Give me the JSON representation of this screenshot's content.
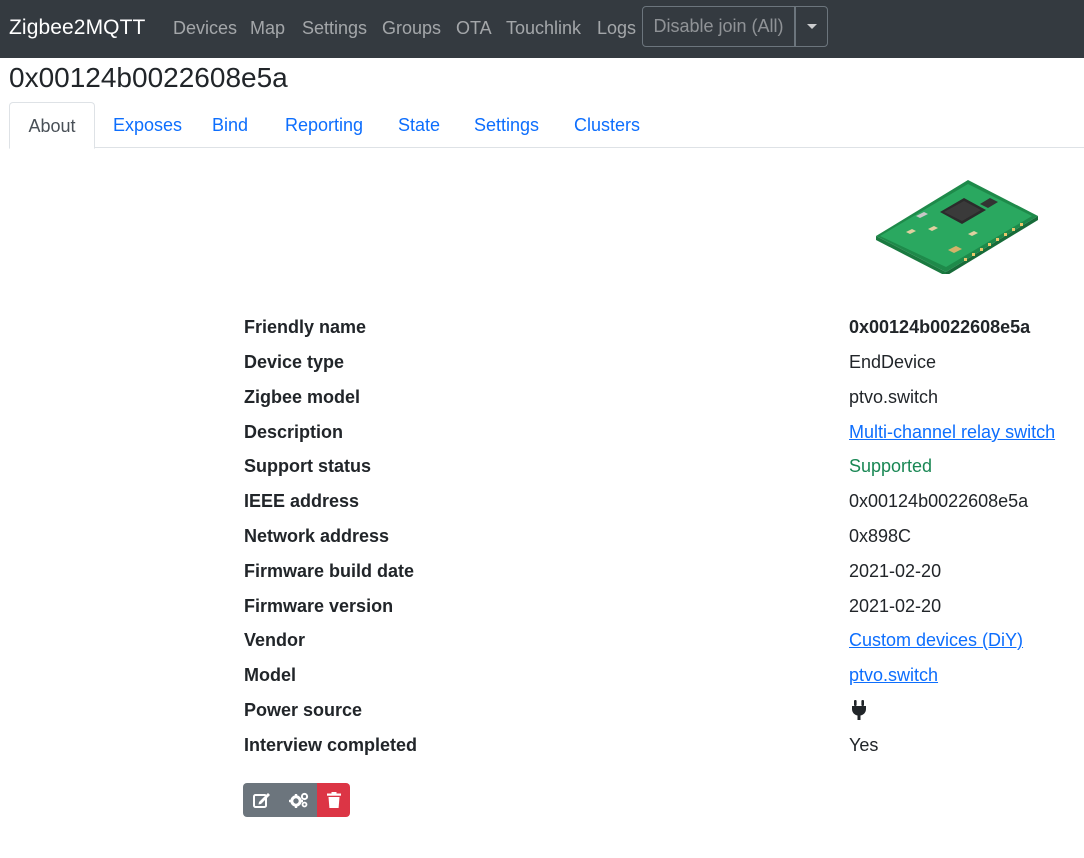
{
  "navbar": {
    "brand": "Zigbee2MQTT",
    "links": [
      "Devices",
      "Map",
      "Settings",
      "Groups",
      "OTA",
      "Touchlink",
      "Logs"
    ],
    "join_button": "Disable join (All)"
  },
  "device": {
    "title": "0x00124b0022608e5a"
  },
  "tabs": [
    "About",
    "Exposes",
    "Bind",
    "Reporting",
    "State",
    "Settings",
    "Clusters"
  ],
  "active_tab": "About",
  "info": [
    {
      "label": "Friendly name",
      "value": "0x00124b0022608e5a",
      "style": "bold"
    },
    {
      "label": "Device type",
      "value": "EndDevice",
      "style": "plain"
    },
    {
      "label": "Zigbee model",
      "value": "ptvo.switch",
      "style": "plain"
    },
    {
      "label": "Description",
      "value": "Multi-channel relay switch",
      "style": "link"
    },
    {
      "label": "Support status",
      "value": "Supported",
      "style": "green"
    },
    {
      "label": "IEEE address",
      "value": "0x00124b0022608e5a",
      "style": "plain"
    },
    {
      "label": "Network address",
      "value": "0x898C",
      "style": "plain"
    },
    {
      "label": "Firmware build date",
      "value": "2021-02-20",
      "style": "plain"
    },
    {
      "label": "Firmware version",
      "value": "2021-02-20",
      "style": "plain"
    },
    {
      "label": "Vendor",
      "value": "Custom devices (DiY)",
      "style": "link"
    },
    {
      "label": "Model",
      "value": "ptvo.switch",
      "style": "link"
    },
    {
      "label": "Power source",
      "value": "",
      "style": "icon",
      "icon": "plug-icon"
    },
    {
      "label": "Interview completed",
      "value": "Yes",
      "style": "plain"
    }
  ],
  "actions": [
    {
      "icon": "edit-icon"
    },
    {
      "icon": "cogs-icon"
    },
    {
      "icon": "trash-icon"
    }
  ],
  "colors": {
    "navbar_bg": "#343a40",
    "link": "#0d6efd",
    "supported": "#198754",
    "danger": "#dc3545",
    "secondary": "#6c757d"
  }
}
